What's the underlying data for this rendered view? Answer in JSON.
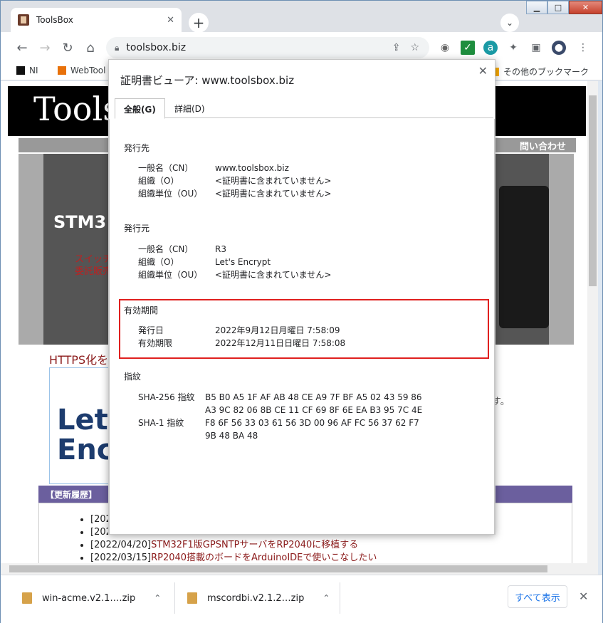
{
  "tab": {
    "title": "ToolsBox",
    "close": "✕"
  },
  "toolbar": {
    "url": "toolsbox.biz"
  },
  "bookmarks": {
    "items": [
      "NI",
      "WebTool"
    ],
    "other": "その他のブックマーク"
  },
  "page": {
    "logo": "Tools",
    "nav_contact": "問い合わせ",
    "hero_title": "STM3",
    "hero_sub1": "スイッチ",
    "hero_sub2": "委託販売",
    "https_heading": "HTTPS化を",
    "le_line1": "Let'",
    "le_line2": "Enc",
    "side1": "。",
    "side2": "す。",
    "updates_title": "【更新履歴】",
    "updates": [
      {
        "date": "[202",
        "text": ""
      },
      {
        "date": "[202",
        "text": ""
      },
      {
        "date": "[2022/04/20]",
        "text": "STM32F1版GPSNTPサーバをRP2040に移植する"
      },
      {
        "date": "[2022/03/15]",
        "text": "RP2040搭載のボードをArduinoIDEで使いこなしたい"
      }
    ]
  },
  "downloads": {
    "items": [
      {
        "name": "win-acme.v2.1.…zip"
      },
      {
        "name": "mscordbi.v2.1.2…zip"
      }
    ],
    "show_all": "すべて表示"
  },
  "dialog": {
    "title": "証明書ビューア: www.toolsbox.biz",
    "tab_general": "全般(G)",
    "tab_details": "詳細(D)",
    "issued_to": {
      "heading": "発行先",
      "rows": [
        {
          "k": "一般名（CN）",
          "v": "www.toolsbox.biz"
        },
        {
          "k": "組織（O）",
          "v": "<証明書に含まれていません>"
        },
        {
          "k": "組織単位（OU）",
          "v": "<証明書に含まれていません>"
        }
      ]
    },
    "issued_by": {
      "heading": "発行元",
      "rows": [
        {
          "k": "一般名（CN）",
          "v": "R3"
        },
        {
          "k": "組織（O）",
          "v": "Let's Encrypt"
        },
        {
          "k": "組織単位（OU）",
          "v": "<証明書に含まれていません>"
        }
      ]
    },
    "validity": {
      "heading": "有効期間",
      "rows": [
        {
          "k": "発行日",
          "v": "2022年9月12日月曜日 7:58:09"
        },
        {
          "k": "有効期限",
          "v": "2022年12月11日日曜日 7:58:08"
        }
      ]
    },
    "fingerprints": {
      "heading": "指紋",
      "sha256_label": "SHA-256 指紋",
      "sha256_l1": "B5 B0 A5 1F AF AB 48 CE A9 7F BF A5 02 43 59 86",
      "sha256_l2": "A3 9C 82 06 8B CE 11 CF 69 8F 6E EA B3 95 7C 4E",
      "sha1_label": "SHA-1 指紋",
      "sha1_l1": "F8 6F 56 33 03 61 56 3D 00 96 AF FC 56 37 62 F7",
      "sha1_l2": "9B 48 BA 48"
    }
  }
}
